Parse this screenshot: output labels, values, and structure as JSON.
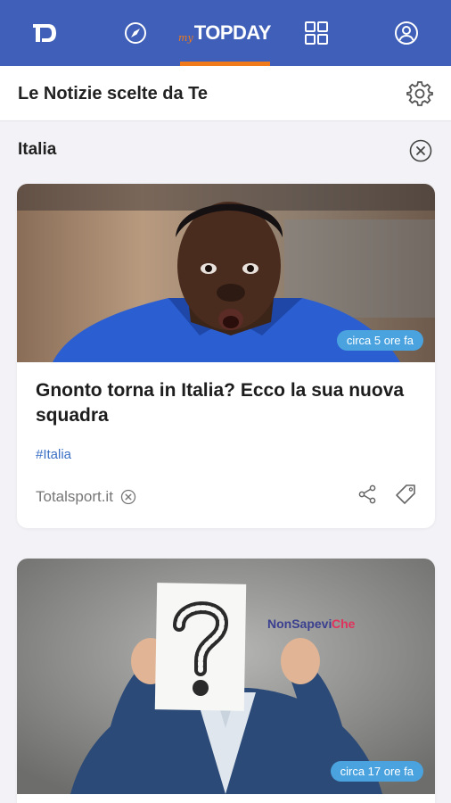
{
  "nav": {
    "logo_text": "D",
    "brand_prefix": "my",
    "brand_name": "TOPDAY",
    "accent_color": "#f07a1a",
    "bar_color": "#3f5fb8",
    "items": [
      {
        "icon": "topday-logo-icon"
      },
      {
        "icon": "compass-icon"
      },
      {
        "icon": "myday-brand",
        "active": true
      },
      {
        "icon": "grid-icon"
      },
      {
        "icon": "user-circle-icon"
      }
    ]
  },
  "header": {
    "title": "Le Notizie scelte da Te",
    "settings_icon": "gear-icon"
  },
  "topic": {
    "title": "Italia",
    "close_icon": "close-circle-icon"
  },
  "articles": [
    {
      "time": "circa 5 ore fa",
      "headline": "Gnonto torna in Italia? Ecco la sua nuova squadra",
      "hashtag": "#Italia",
      "source": "Totalsport.it",
      "image": "football-player-photo"
    },
    {
      "time": "circa 17 ore fa",
      "image": "question-mark-sign-photo",
      "image_text_a": "NonSapevi",
      "image_text_b": "Che"
    }
  ],
  "colors": {
    "badge": "#4aa3df",
    "hashtag": "#3a6fc4",
    "background": "#f3f3f7"
  }
}
